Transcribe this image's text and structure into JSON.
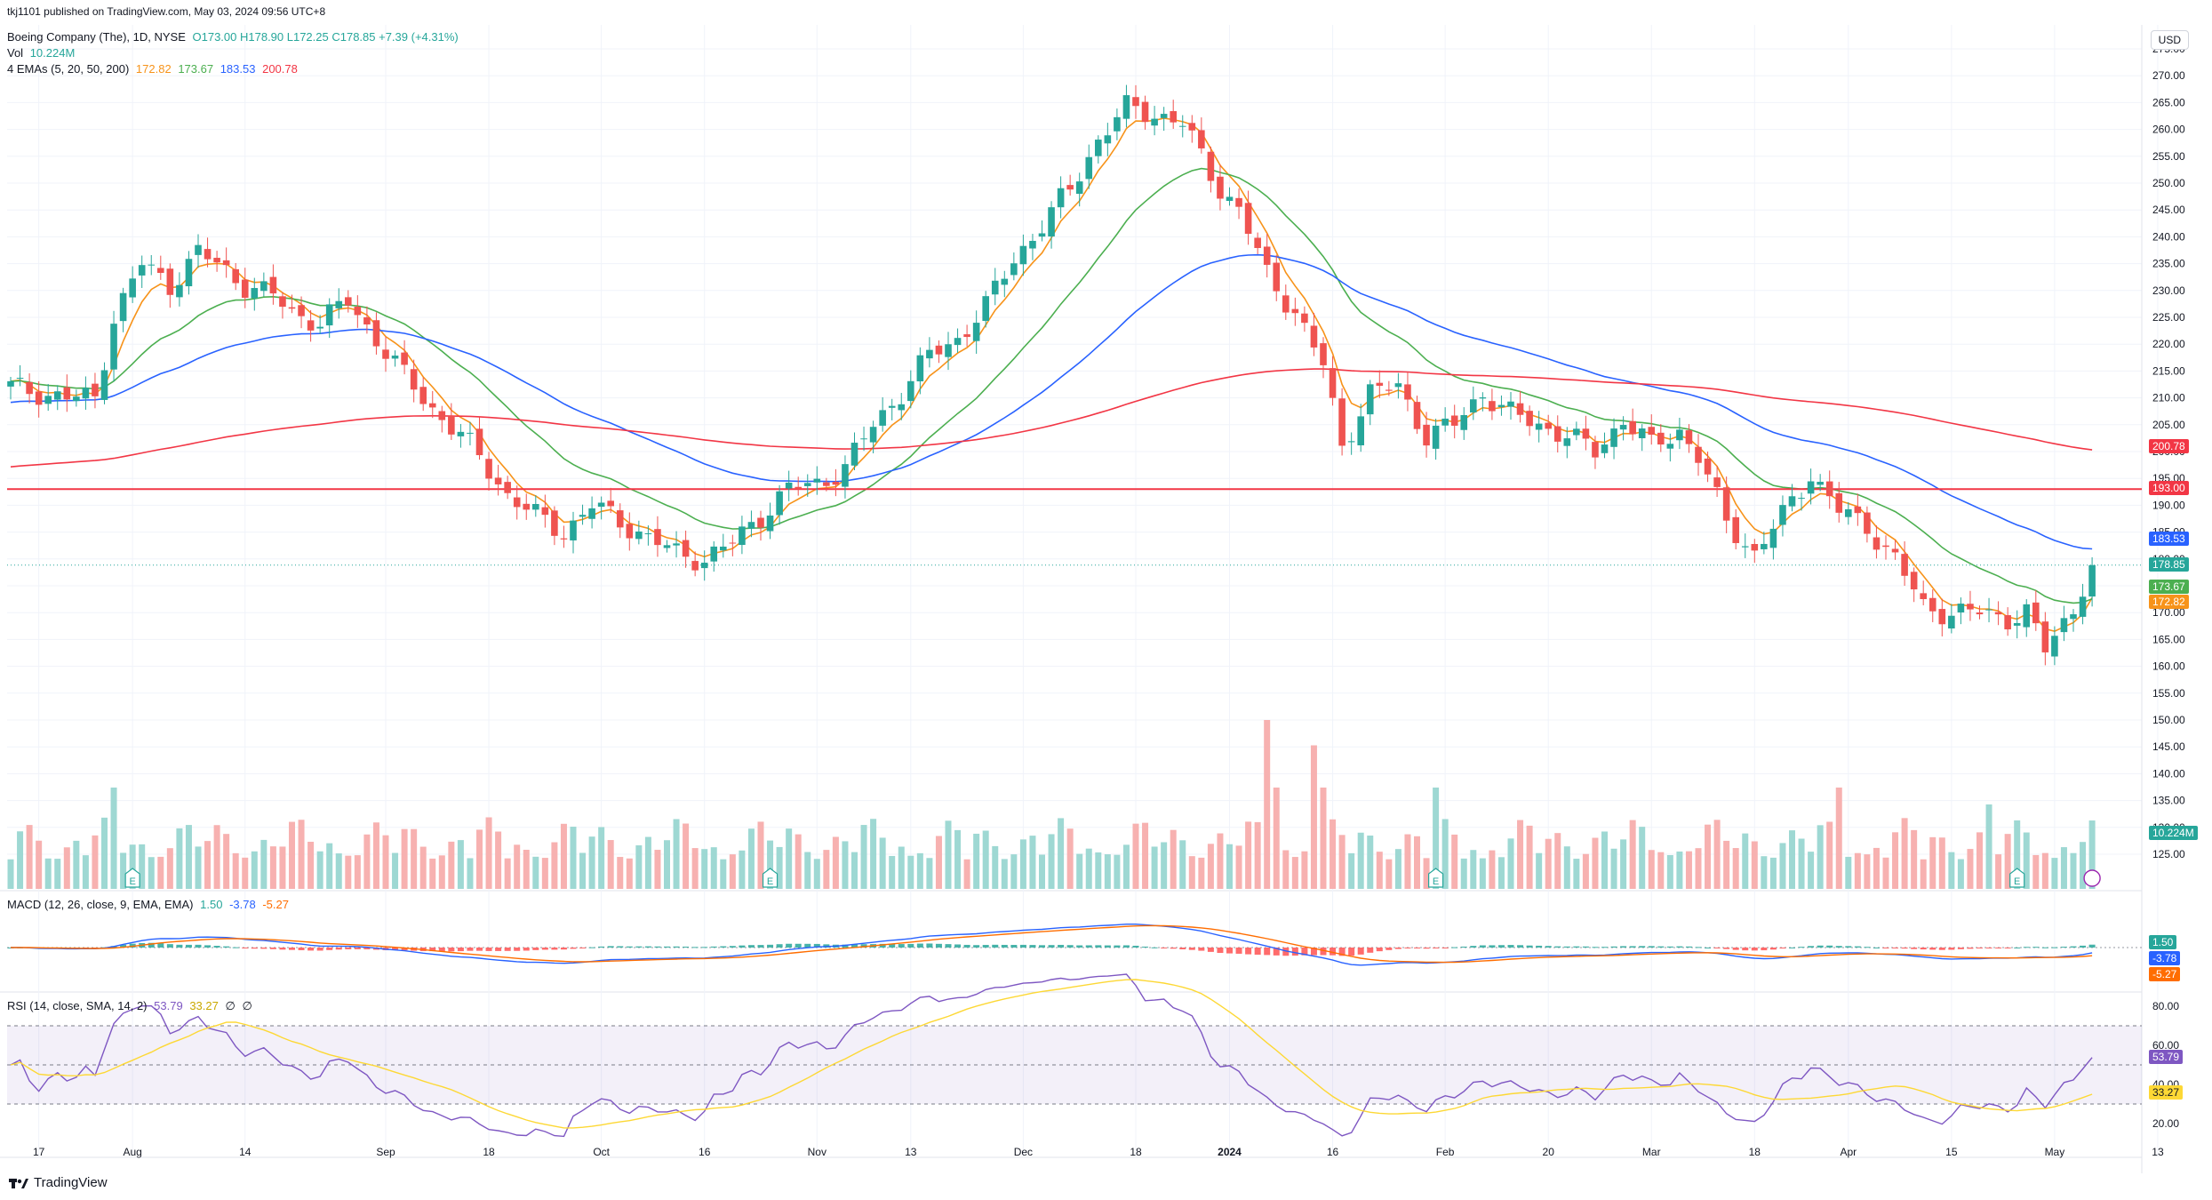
{
  "publisher_line": "tkj1101 published on TradingView.com, May 03, 2024 09:56 UTC+8",
  "legend": {
    "symbol": "Boeing Company (The), 1D, NYSE",
    "ohlc": "O173.00 H178.90 L172.25 C178.85 +7.39 (+4.31%)",
    "vol_label": "Vol",
    "vol_value": "10.224M",
    "ema_label": "4 EMAs (5, 20, 50, 200)",
    "ema_values": [
      "172.82",
      "173.67",
      "183.53",
      "200.78"
    ],
    "macd_label": "MACD (12, 26, close, 9, EMA, EMA)",
    "macd_values": [
      "1.50",
      "-3.78",
      "-5.27"
    ],
    "rsi_label": "RSI (14, close, SMA, 14, 2)",
    "rsi_values": [
      "53.79",
      "33.27",
      "∅",
      "∅"
    ]
  },
  "currency_button": "USD",
  "colors": {
    "up": "#26a69a",
    "down": "#ef5350",
    "ema5": "#f7931a",
    "ema20": "#4caf50",
    "ema50": "#2962ff",
    "ema200": "#f23645",
    "hline": "#f23645",
    "macd": "#2962ff",
    "signal": "#ff6d00",
    "rsi": "#7e57c2",
    "rsi_ma": "#fdd835"
  },
  "price_badges": [
    "200.78",
    "193.00",
    "183.53",
    "178.85",
    "173.67",
    "172.82",
    "10.224M"
  ],
  "macd_badges": [
    "1.50",
    "-3.78",
    "-5.27"
  ],
  "rsi_badges": [
    "53.79",
    "33.27"
  ],
  "footer": "TradingView",
  "chart_data": {
    "type": "candlestick",
    "symbol": "BA",
    "timeframe": "1D",
    "price_axis": {
      "min": 125,
      "max": 275,
      "ticks": [
        "275.00",
        "270.00",
        "265.00",
        "260.00",
        "255.00",
        "250.00",
        "245.00",
        "240.00",
        "235.00",
        "230.00",
        "225.00",
        "220.00",
        "215.00",
        "210.00",
        "205.00",
        "200.00",
        "195.00",
        "190.00",
        "185.00",
        "180.00",
        "175.00",
        "170.00",
        "165.00",
        "160.00",
        "155.00",
        "150.00",
        "145.00",
        "140.00",
        "135.00",
        "130.00",
        "125.00"
      ]
    },
    "rsi_axis": {
      "ticks": [
        "80.00",
        "60.00",
        "40.00",
        "20.00"
      ],
      "overbought": 70,
      "oversold": 30
    },
    "x_ticks": [
      "17",
      "Aug",
      "14",
      "Sep",
      "18",
      "Oct",
      "16",
      "Nov",
      "13",
      "Dec",
      "18",
      "2024",
      "16",
      "Feb",
      "20",
      "Mar",
      "18",
      "Apr",
      "15",
      "May",
      "13"
    ],
    "horizontal_line": 193.0,
    "earnings_markers": [
      "E",
      "E",
      "E",
      "E"
    ],
    "close_anchors": [
      [
        0,
        212
      ],
      [
        3,
        211
      ],
      [
        6,
        210
      ],
      [
        9,
        210
      ],
      [
        11,
        225
      ],
      [
        14,
        235
      ],
      [
        17,
        231
      ],
      [
        20,
        237
      ],
      [
        22,
        235
      ],
      [
        25,
        231
      ],
      [
        28,
        229
      ],
      [
        30,
        226
      ],
      [
        33,
        224
      ],
      [
        36,
        228
      ],
      [
        39,
        221
      ],
      [
        42,
        214
      ],
      [
        45,
        208
      ],
      [
        48,
        203
      ],
      [
        50,
        199
      ],
      [
        53,
        192
      ],
      [
        56,
        188
      ],
      [
        59,
        185
      ],
      [
        62,
        190
      ],
      [
        65,
        187
      ],
      [
        68,
        184
      ],
      [
        71,
        181
      ],
      [
        74,
        180
      ],
      [
        77,
        183
      ],
      [
        80,
        188
      ],
      [
        83,
        193
      ],
      [
        86,
        194
      ],
      [
        89,
        197
      ],
      [
        92,
        205
      ],
      [
        95,
        211
      ],
      [
        98,
        218
      ],
      [
        101,
        221
      ],
      [
        104,
        227
      ],
      [
        107,
        236
      ],
      [
        110,
        242
      ],
      [
        113,
        249
      ],
      [
        116,
        258
      ],
      [
        119,
        264
      ],
      [
        122,
        263
      ],
      [
        125,
        261
      ],
      [
        127,
        255
      ],
      [
        129,
        249
      ],
      [
        131,
        245
      ],
      [
        134,
        233
      ],
      [
        137,
        226
      ],
      [
        140,
        216
      ],
      [
        142,
        201
      ],
      [
        145,
        211
      ],
      [
        148,
        212
      ],
      [
        151,
        203
      ],
      [
        154,
        205
      ],
      [
        157,
        211
      ],
      [
        160,
        207
      ],
      [
        163,
        205
      ],
      [
        166,
        203
      ],
      [
        169,
        200
      ],
      [
        172,
        206
      ],
      [
        175,
        201
      ],
      [
        178,
        204
      ],
      [
        180,
        199
      ],
      [
        183,
        187
      ],
      [
        186,
        181
      ],
      [
        189,
        188
      ],
      [
        192,
        196
      ],
      [
        195,
        189
      ],
      [
        198,
        186
      ],
      [
        201,
        180
      ],
      [
        204,
        171
      ],
      [
        207,
        170
      ],
      [
        210,
        170
      ],
      [
        213,
        169
      ],
      [
        215,
        170
      ],
      [
        217,
        163
      ],
      [
        220,
        171
      ],
      [
        222,
        178.85
      ]
    ],
    "ema_period_labels": [
      "5",
      "20",
      "50",
      "200"
    ]
  }
}
